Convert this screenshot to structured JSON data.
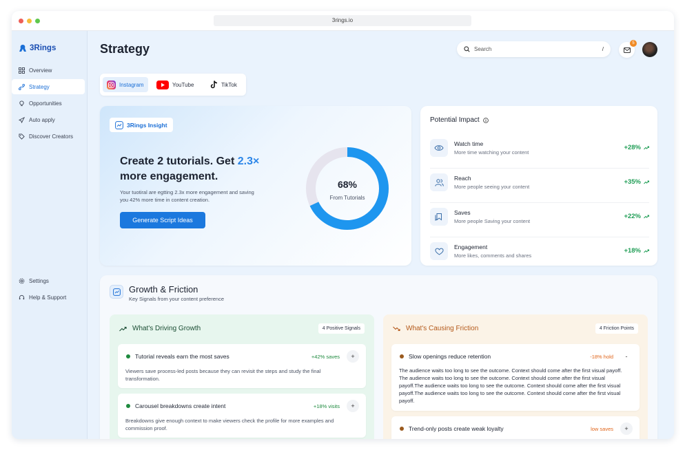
{
  "browser": {
    "url": "3rings.io"
  },
  "brand": {
    "name": "3Rings",
    "color": "#1b4fb3"
  },
  "sidebar": {
    "items": [
      {
        "label": "Overview",
        "icon": "grid-icon"
      },
      {
        "label": "Strategy",
        "icon": "strategy-icon",
        "active": true
      },
      {
        "label": "Opportunities",
        "icon": "lightbulb-icon"
      },
      {
        "label": "Auto apply",
        "icon": "rocket-icon"
      },
      {
        "label": "Discover Creators",
        "icon": "tag-icon"
      }
    ],
    "bottom_items": [
      {
        "label": "Settings",
        "icon": "gear-icon"
      },
      {
        "label": "Help & Support",
        "icon": "headset-icon"
      }
    ]
  },
  "header": {
    "title": "Strategy",
    "search_placeholder": "Search",
    "search_shortcut": "/",
    "notification_count": "5"
  },
  "platforms": [
    {
      "label": "Instagram",
      "icon": "instagram-icon",
      "active": true
    },
    {
      "label": "YouTube",
      "icon": "youtube-icon"
    },
    {
      "label": "TikTok",
      "icon": "tiktok-icon"
    }
  ],
  "insight": {
    "pill": "3Rings Insight",
    "headline_before": "Create 2 tutorials. Get ",
    "headline_accent": "2.3×",
    "headline_after": " more engagement.",
    "subtext": "Your tuotiral are egtting 2.3x more engagement and saving you 42% more time in content creation.",
    "cta": "Generate Script Ideas",
    "donut_value": "68%",
    "donut_fraction": 0.68,
    "donut_label": "From Tutorials",
    "accent_color": "#2c86e8"
  },
  "impact": {
    "title": "Potential Impact",
    "rows": [
      {
        "name": "Watch time",
        "desc": "More time watching your content",
        "value": "+28%",
        "icon": "eye-icon"
      },
      {
        "name": "Reach",
        "desc": "More people seeing your content",
        "value": "+35%",
        "icon": "users-icon"
      },
      {
        "name": "Saves",
        "desc": "More people Saving your content",
        "value": "+22%",
        "icon": "bookmark-icon"
      },
      {
        "name": "Engagement",
        "desc": "More likes, comments and shares",
        "value": "+18%",
        "icon": "heart-icon"
      }
    ]
  },
  "growth_friction": {
    "title": "Growth & Friction",
    "subtitle": "Key Signals from your content preference",
    "growth": {
      "title": "What's Driving Growth",
      "pill": "4 Positive Signals",
      "signals": [
        {
          "title": "Tutorial reveals earn the most saves",
          "metric": "+42% saves",
          "button": "+",
          "body": "Viewers save process-led posts because they can revisit the steps and study the final transformation."
        },
        {
          "title": "Carousel breakdowns create intent",
          "metric": "+18% visits",
          "button": "+",
          "body": "Breakdowns give enough context to make viewers check the profile for more examples and commission proof."
        }
      ]
    },
    "friction": {
      "title": "What's Causing Friction",
      "pill": "4 Friction Points",
      "signals": [
        {
          "title": "Slow openings reduce retention",
          "metric": "-18% hold",
          "button": "-",
          "body": "The audience waits too long to see the outcome. Context should come after the first visual payoff. The audience waits too long to see the outcome. Context should come after the first visual payoff.The audience waits too long to see the outcome. Context should come after the first visual payoff.The audience waits too long to see the outcome. Context should come after the first visual payoff."
        },
        {
          "title": "Trend-only posts create weak loyalty",
          "metric": "low saves",
          "button": "+",
          "body": ""
        }
      ]
    }
  }
}
